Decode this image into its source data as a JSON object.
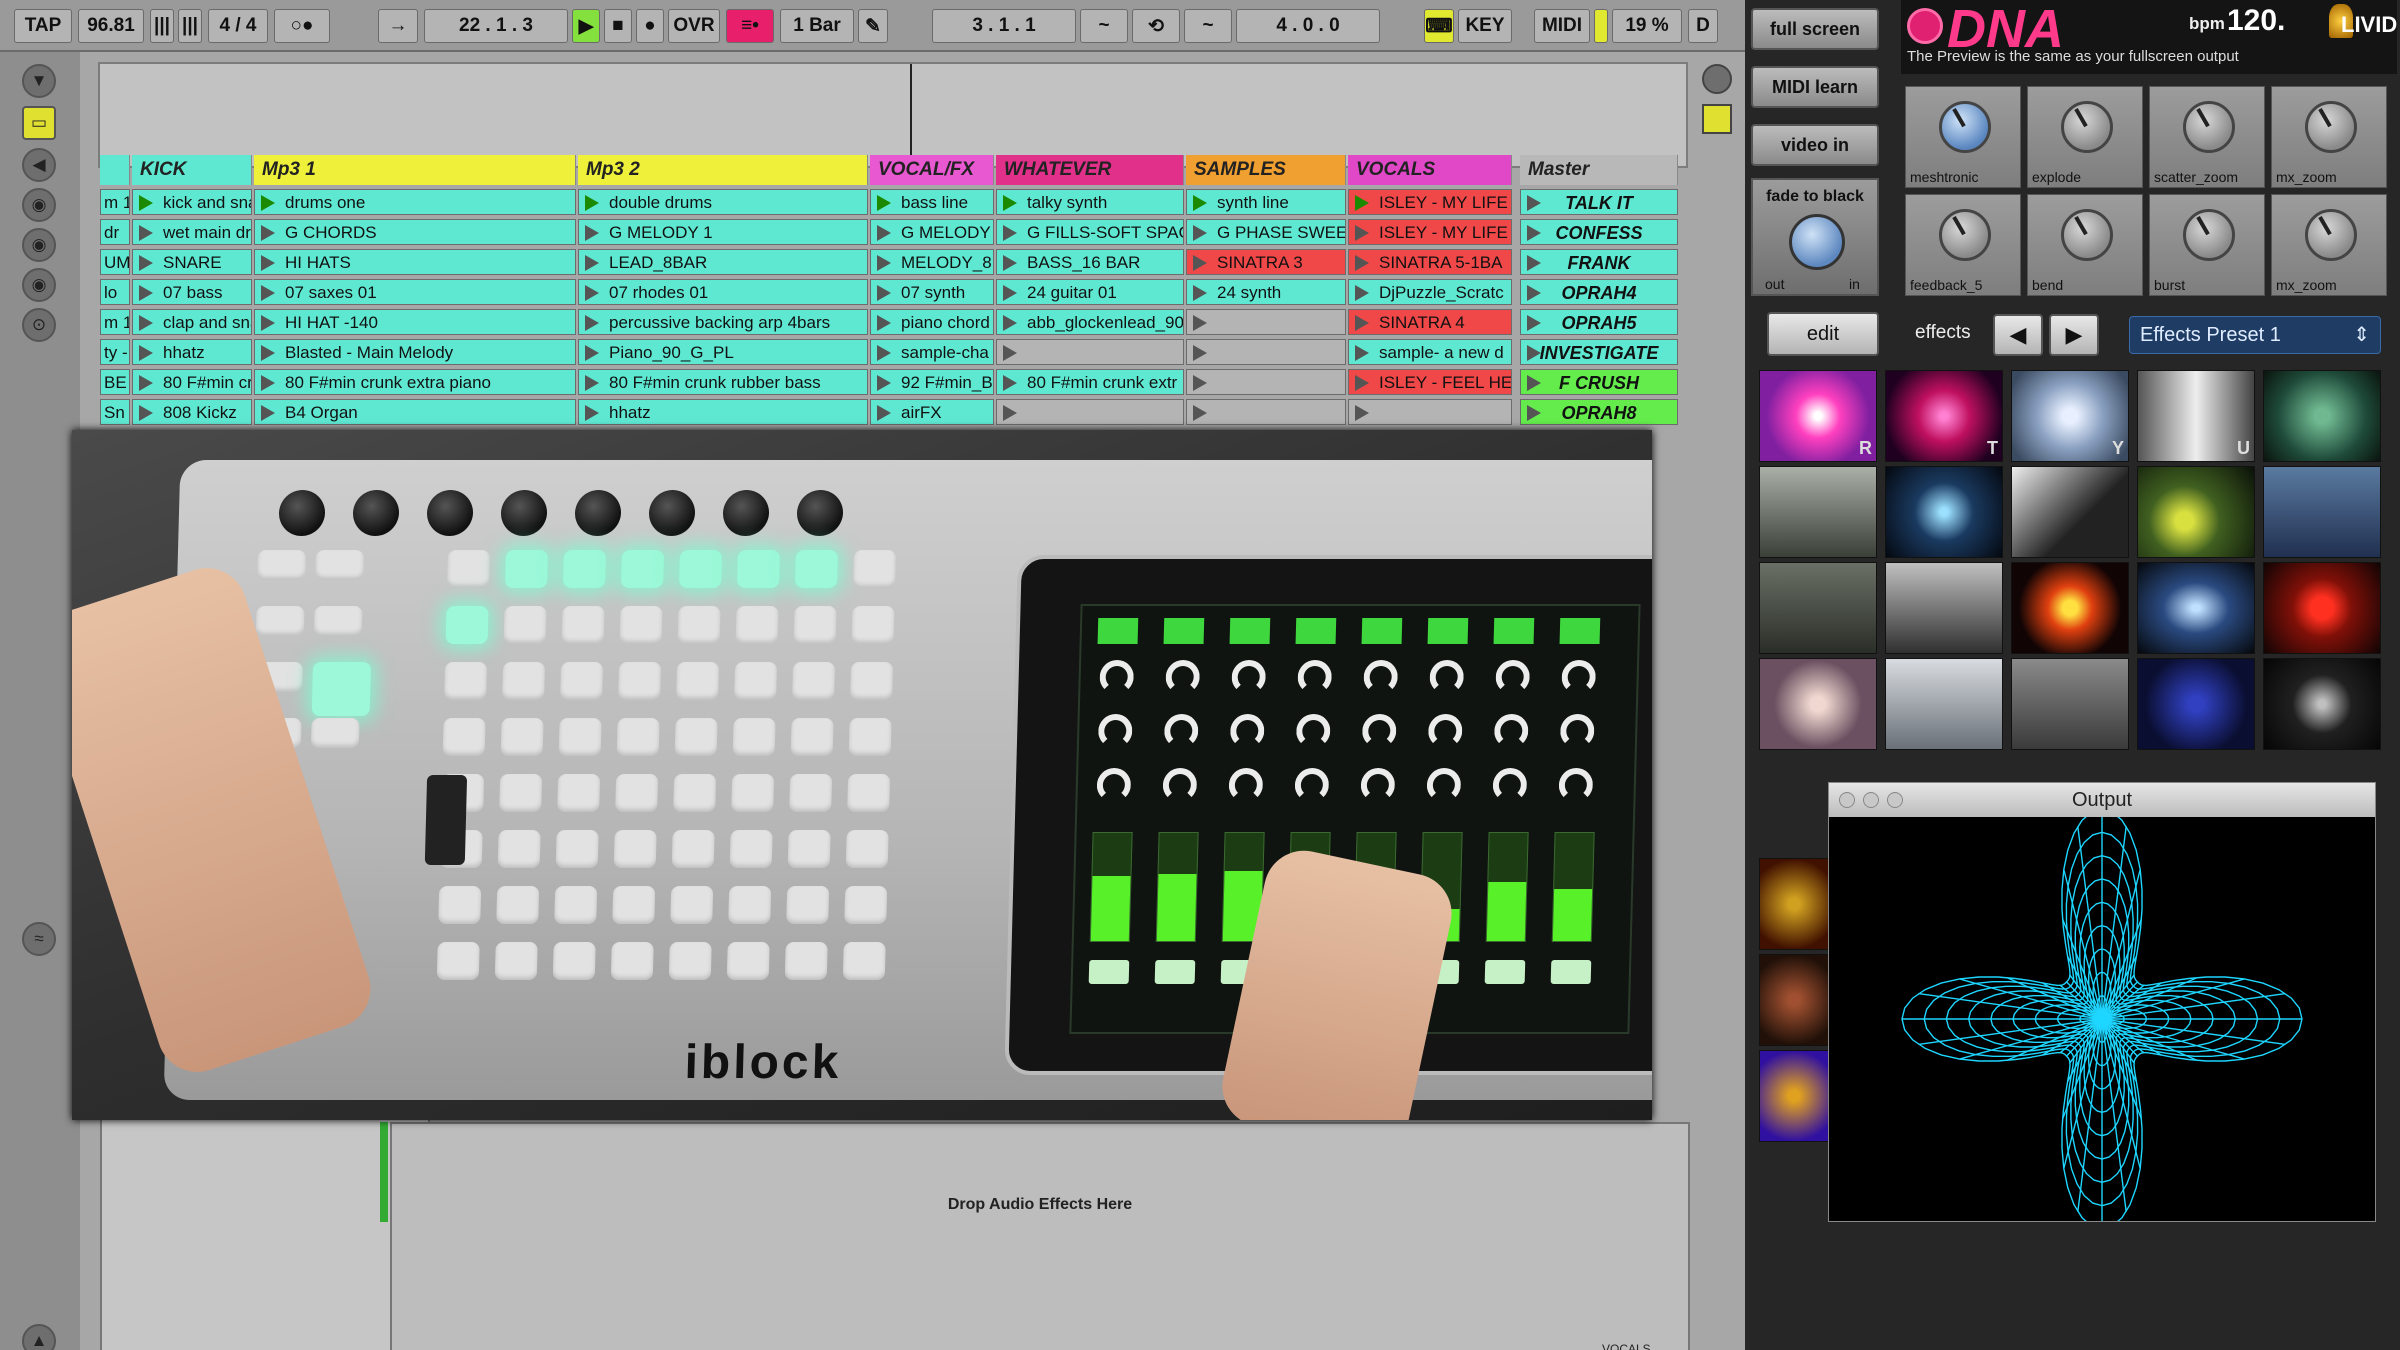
{
  "transport": {
    "tap": "TAP",
    "bpm": "96.81",
    "signature": "4 / 4",
    "position": "22 .  1 .  3",
    "ovr": "OVR",
    "quantize": "1 Bar",
    "loop_start": "3 .  1 .  1",
    "loop_len": "4 .  0 .  0",
    "key": "KEY",
    "midi": "MIDI",
    "cpu": "19 %",
    "d": "D"
  },
  "tracks": [
    {
      "name": "KICK",
      "color": "#5ee8d2"
    },
    {
      "name": "Mp3 1",
      "color": "#eef03a"
    },
    {
      "name": "Mp3 2",
      "color": "#eef03a"
    },
    {
      "name": "VOCAL/FX",
      "color": "#e858d0"
    },
    {
      "name": "WHATEVER",
      "color": "#e0308a"
    },
    {
      "name": "SAMPLES",
      "color": "#f0a030"
    },
    {
      "name": "VOCALS",
      "color": "#e048c8"
    },
    {
      "name": "Master",
      "color": "#b8b8b8"
    }
  ],
  "clips": {
    "col0": [
      "m 1",
      "dr",
      "UM",
      "lo",
      "m 1",
      "ty -",
      "BE",
      "Sn"
    ],
    "col1": [
      "kick and sna",
      "wet main dr",
      "SNARE",
      "07 bass",
      "clap and sna",
      "hhatz",
      "80 F#min cr",
      "808 Kickz"
    ],
    "col2": [
      "drums one",
      "G CHORDS",
      "HI HATS",
      "07 saxes 01",
      "HI HAT -140",
      "Blasted - Main Melody",
      "80 F#min crunk extra piano",
      "B4 Organ"
    ],
    "col3": [
      "double drums",
      "G MELODY 1",
      "LEAD_8BAR",
      "07 rhodes 01",
      "percussive backing arp 4bars",
      "Piano_90_G_PL",
      "80 F#min crunk rubber bass",
      "hhatz"
    ],
    "col4": [
      "bass line",
      "G MELODY",
      "MELODY_8B",
      "07 synth",
      "piano chord",
      "sample-cha",
      "92 F#min_B",
      "airFX"
    ],
    "col5": [
      "talky synth",
      "G FILLS-SOFT SPAC",
      "BASS_16 BAR",
      "24 guitar 01",
      "abb_glockenlead_90",
      "",
      "80 F#min crunk extr",
      ""
    ],
    "col6": [
      "synth line",
      "G PHASE SWEE",
      "SINATRA 3",
      "24 synth",
      "",
      "",
      "",
      ""
    ],
    "col7": [
      "ISLEY - MY LIFE",
      "ISLEY - MY LIFE",
      "SINATRA 5-1BA",
      "DjPuzzle_Scratc",
      "SINATRA 4",
      "sample- a new d",
      "ISLEY - FEEL HE",
      ""
    ],
    "master": [
      "TALK IT",
      "CONFESS",
      "FRANK",
      "OPRAH4",
      "OPRAH5",
      "INVESTIGATE",
      "F CRUSH",
      "OPRAH8"
    ]
  },
  "drop_label": "Drop Audio Effects Here",
  "device_label": "iblock",
  "dna": {
    "full_screen": "full screen",
    "midi_learn": "MIDI learn",
    "video_in": "video in",
    "fade_to_black": "fade to black",
    "fade_out": "out",
    "fade_in": "in",
    "edit": "edit",
    "effects": "effects",
    "preset": "Effects Preset 1",
    "logo": "DNA",
    "bpm_label": "bpm",
    "bpm": "120.",
    "brand": "LIVID",
    "preview_note": "The Preview is the same as your fullscreen output",
    "knobs": [
      "meshtronic",
      "explode",
      "scatter_zoom",
      "mx_zoom",
      "feedback_5",
      "bend",
      "burst",
      "mx_zoom"
    ],
    "thumb_keys": [
      "R",
      "T",
      "Y",
      "U"
    ],
    "output_title": "Output"
  },
  "bottom_track": "VOCALS"
}
